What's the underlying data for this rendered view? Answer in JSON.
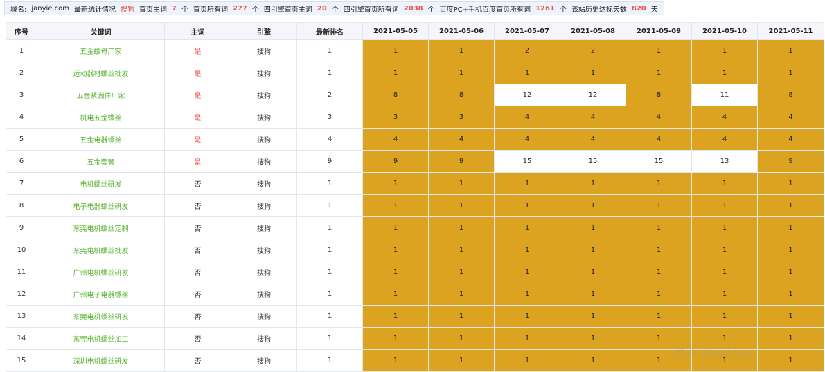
{
  "stats": {
    "domain_label": "域名:",
    "domain": "janyie.com",
    "latest_label": "最新统计情况",
    "engine": "搜狗",
    "home_main_label": "首页主词",
    "home_main_count": "7",
    "unit": "个",
    "home_all_label": "首页所有词",
    "home_all_count": "277",
    "four_main_label": "四引擎首页主词",
    "four_main_count": "20",
    "four_all_label": "四引擎首页所有词",
    "four_all_count": "2038",
    "baidu_label": "百度PC+手机百度首页所有词",
    "baidu_count": "1261",
    "history_label": "该站历史达标天数",
    "history_days": "820",
    "day_unit": "天"
  },
  "table": {
    "headers": [
      "序号",
      "关键词",
      "主词",
      "引擎",
      "最新排名"
    ],
    "dates": [
      "2021-05-05",
      "2021-05-06",
      "2021-05-07",
      "2021-05-08",
      "2021-05-09",
      "2021-05-10",
      "2021-05-11"
    ],
    "rows": [
      {
        "no": "1",
        "keyword": "五金螺母厂家",
        "main": "是",
        "engine": "搜狗",
        "latest": "1",
        "ranks": [
          "1",
          "1",
          "2",
          "2",
          "1",
          "1",
          "1"
        ]
      },
      {
        "no": "2",
        "keyword": "运动器材螺丝批发",
        "main": "是",
        "engine": "搜狗",
        "latest": "1",
        "ranks": [
          "1",
          "1",
          "1",
          "1",
          "1",
          "1",
          "1"
        ]
      },
      {
        "no": "3",
        "keyword": "五金紧固件厂家",
        "main": "是",
        "engine": "搜狗",
        "latest": "2",
        "ranks": [
          "8",
          "8",
          "12",
          "12",
          "8",
          "11",
          "8"
        ]
      },
      {
        "no": "4",
        "keyword": "机电五金螺丝",
        "main": "是",
        "engine": "搜狗",
        "latest": "3",
        "ranks": [
          "3",
          "3",
          "4",
          "4",
          "4",
          "4",
          "4"
        ]
      },
      {
        "no": "5",
        "keyword": "五金电器螺丝",
        "main": "是",
        "engine": "搜狗",
        "latest": "4",
        "ranks": [
          "4",
          "4",
          "4",
          "4",
          "4",
          "4",
          "4"
        ]
      },
      {
        "no": "6",
        "keyword": "五金套管",
        "main": "是",
        "engine": "搜狗",
        "latest": "9",
        "ranks": [
          "9",
          "9",
          "15",
          "15",
          "15",
          "13",
          "9"
        ]
      },
      {
        "no": "7",
        "keyword": "电机螺丝研发",
        "main": "否",
        "engine": "搜狗",
        "latest": "1",
        "ranks": [
          "1",
          "1",
          "1",
          "1",
          "1",
          "1",
          "1"
        ]
      },
      {
        "no": "8",
        "keyword": "电子电器螺丝研发",
        "main": "否",
        "engine": "搜狗",
        "latest": "1",
        "ranks": [
          "1",
          "1",
          "1",
          "1",
          "1",
          "1",
          "1"
        ]
      },
      {
        "no": "9",
        "keyword": "东莞电机螺丝定制",
        "main": "否",
        "engine": "搜狗",
        "latest": "1",
        "ranks": [
          "1",
          "1",
          "1",
          "1",
          "1",
          "1",
          "1"
        ]
      },
      {
        "no": "10",
        "keyword": "东莞电机螺丝批发",
        "main": "否",
        "engine": "搜狗",
        "latest": "1",
        "ranks": [
          "1",
          "1",
          "1",
          "1",
          "1",
          "1",
          "1"
        ]
      },
      {
        "no": "11",
        "keyword": "广州电机螺丝研发",
        "main": "否",
        "engine": "搜狗",
        "latest": "1",
        "ranks": [
          "1",
          "1",
          "1",
          "1",
          "1",
          "1",
          "1"
        ]
      },
      {
        "no": "12",
        "keyword": "广州电子电器螺丝",
        "main": "否",
        "engine": "搜狗",
        "latest": "1",
        "ranks": [
          "1",
          "1",
          "1",
          "1",
          "1",
          "1",
          "1"
        ]
      },
      {
        "no": "13",
        "keyword": "东莞电机螺丝研发",
        "main": "否",
        "engine": "搜狗",
        "latest": "1",
        "ranks": [
          "1",
          "1",
          "1",
          "1",
          "1",
          "1",
          "1"
        ]
      },
      {
        "no": "14",
        "keyword": "东莞电机螺丝加工",
        "main": "否",
        "engine": "搜狗",
        "latest": "1",
        "ranks": [
          "1",
          "1",
          "1",
          "1",
          "1",
          "1",
          "1"
        ]
      },
      {
        "no": "15",
        "keyword": "深圳电机螺丝研发",
        "main": "否",
        "engine": "搜狗",
        "latest": "1",
        "ranks": [
          "1",
          "1",
          "1",
          "1",
          "1",
          "1",
          "1"
        ]
      }
    ]
  },
  "colors": {
    "on_home": "#dba320",
    "off_home": "#ffffff",
    "keyword": "#5ab431",
    "highlight": "#e8554e"
  },
  "watermark": "激活 Windows"
}
